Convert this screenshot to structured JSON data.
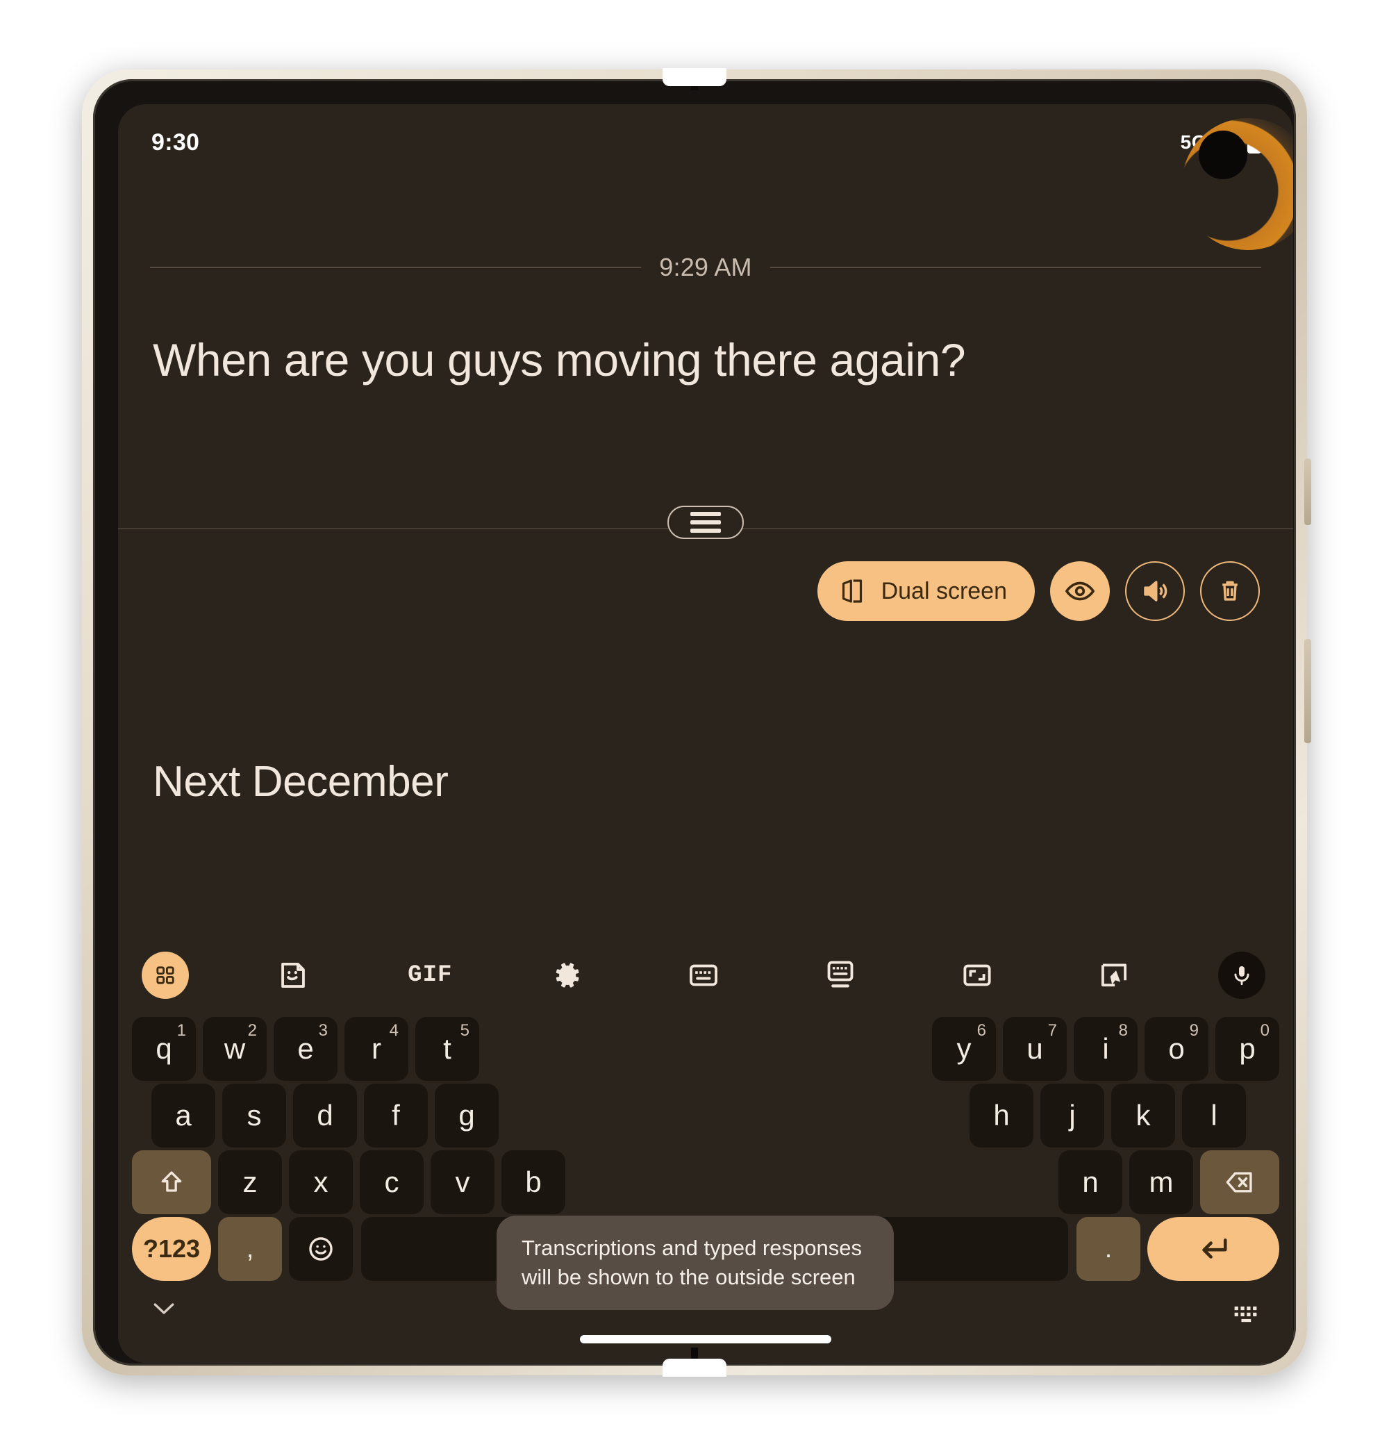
{
  "status_bar": {
    "time": "9:30",
    "network": "5G",
    "icons": [
      "signal-icon",
      "battery-icon"
    ]
  },
  "transcript": {
    "timestamp": "9:29 AM",
    "message": "When are you guys moving there again?"
  },
  "actions": {
    "dual_screen_label": "Dual screen",
    "dual_screen_icon": "dual-screen-icon",
    "eye_icon": "eye-icon",
    "volume_icon": "volume-up-icon",
    "delete_icon": "trash-icon"
  },
  "reply": {
    "text": "Next December"
  },
  "keyboard": {
    "toolbar": [
      {
        "name": "apps-grid-icon",
        "label": ""
      },
      {
        "name": "sticker-icon",
        "label": ""
      },
      {
        "name": "gif-icon",
        "label": "GIF"
      },
      {
        "name": "settings-gear-icon",
        "label": ""
      },
      {
        "name": "keyboard-icon",
        "label": ""
      },
      {
        "name": "floating-keyboard-icon",
        "label": ""
      },
      {
        "name": "resize-keyboard-icon",
        "label": ""
      },
      {
        "name": "handwriting-icon",
        "label": ""
      },
      {
        "name": "microphone-icon",
        "label": ""
      }
    ],
    "row1_left": [
      {
        "key": "q",
        "sup": "1"
      },
      {
        "key": "w",
        "sup": "2"
      },
      {
        "key": "e",
        "sup": "3"
      },
      {
        "key": "r",
        "sup": "4"
      },
      {
        "key": "t",
        "sup": "5"
      }
    ],
    "row1_right": [
      {
        "key": "y",
        "sup": "6"
      },
      {
        "key": "u",
        "sup": "7"
      },
      {
        "key": "i",
        "sup": "8"
      },
      {
        "key": "o",
        "sup": "9"
      },
      {
        "key": "p",
        "sup": "0"
      }
    ],
    "row2_left": [
      {
        "key": "a"
      },
      {
        "key": "s"
      },
      {
        "key": "d"
      },
      {
        "key": "f"
      },
      {
        "key": "g"
      }
    ],
    "row2_right": [
      {
        "key": "h"
      },
      {
        "key": "j"
      },
      {
        "key": "k"
      },
      {
        "key": "l"
      }
    ],
    "row3_left": [
      {
        "key": "z"
      },
      {
        "key": "x"
      },
      {
        "key": "c"
      },
      {
        "key": "v"
      },
      {
        "key": "b"
      }
    ],
    "row3_right": [
      {
        "key": "n"
      },
      {
        "key": "m"
      }
    ],
    "shift_icon": "shift-icon",
    "backspace_icon": "backspace-icon",
    "symbols_label": "?123",
    "comma_label": ",",
    "emoji_icon": "emoji-icon",
    "space_label": "",
    "period_label": ".",
    "enter_icon": "enter-icon",
    "collapse_icon": "chevron-down-icon",
    "dismiss_icon": "keyboard-dismiss-icon",
    "tooltip": "Transcriptions and typed responses will be shown to the outside screen"
  },
  "colors": {
    "screen_bg": "#2b241d",
    "accent": "#f6c183",
    "key_bg": "#1b1510",
    "fn_key_bg": "#6b573c",
    "text": "#f1e7dd",
    "tooltip_bg": "#574d44"
  }
}
